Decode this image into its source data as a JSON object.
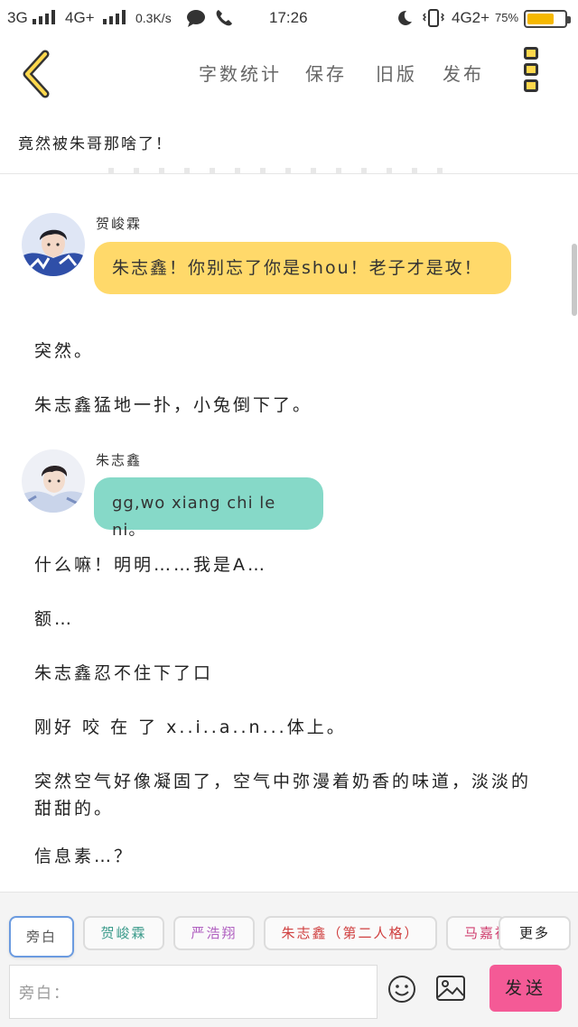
{
  "status_bar": {
    "network1": "3G",
    "network2": "4G+",
    "speed": "0.3K/s",
    "time": "17:26",
    "network3": "4G2+",
    "battery": "75%",
    "battery_level": 0.75
  },
  "toolbar": {
    "word_count": "字数统计",
    "save": "保存",
    "old_version": "旧版",
    "publish": "发布"
  },
  "chapter": {
    "title": "竟然被朱哥那啥了！"
  },
  "messages": [
    {
      "type": "dialogue",
      "name": "贺峻霖",
      "text": "朱志鑫！你别忘了你是shou！老子才是攻！",
      "bubble_color": "#ffd96a"
    },
    {
      "type": "narration",
      "text": "突然。"
    },
    {
      "type": "narration",
      "text": "朱志鑫猛地一扑，小兔倒下了。"
    },
    {
      "type": "dialogue",
      "name": "朱志鑫",
      "text": "gg,wo xiang chi le ni。",
      "bubble_color": "#86d9c8"
    },
    {
      "type": "narration",
      "text": "什么嘛！明明……我是A…"
    },
    {
      "type": "narration",
      "text": "额…"
    },
    {
      "type": "narration",
      "text": "朱志鑫忍不住下了口"
    },
    {
      "type": "narration",
      "text": "刚好 咬 在 了 x..i..a..n...体上。"
    },
    {
      "type": "narration",
      "text": "突然空气好像凝固了，空气中弥漫着奶香的味道，淡淡的甜甜的。"
    },
    {
      "type": "narration",
      "text": "信息素…？"
    }
  ],
  "characters": [
    {
      "name": "旁白",
      "color": "#555555"
    },
    {
      "name": "贺峻霖",
      "color": "#3a9a8a"
    },
    {
      "name": "严浩翔",
      "color": "#b060c0"
    },
    {
      "name": "朱志鑫（第二人格）",
      "color": "#d04040"
    },
    {
      "name": "马嘉祺",
      "color": "#d04070"
    }
  ],
  "more_label": "更多",
  "input": {
    "placeholder": "旁白："
  },
  "emoji_icon": "smile-icon",
  "image_icon": "image-icon",
  "send_label": "发送"
}
